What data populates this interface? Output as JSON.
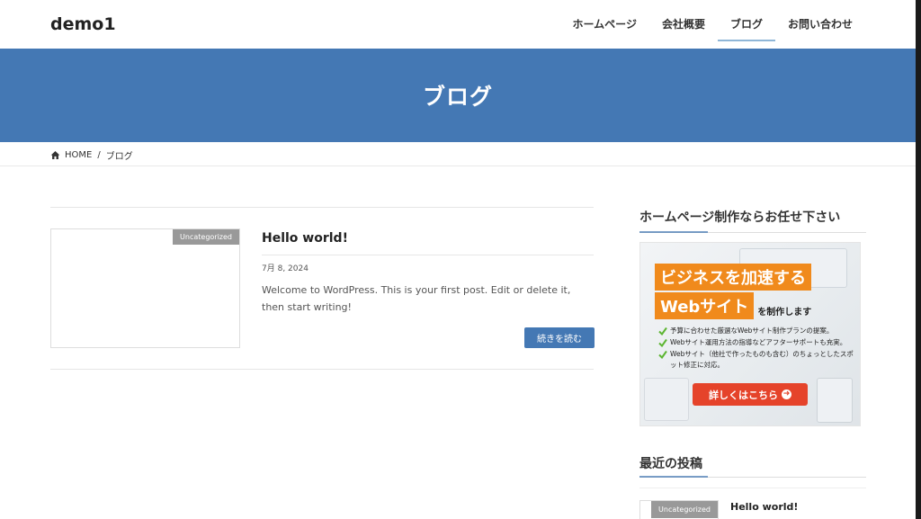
{
  "header": {
    "site_title": "demo1",
    "nav": [
      {
        "label": "ホームページ",
        "active": false
      },
      {
        "label": "会社概要",
        "active": false
      },
      {
        "label": "ブログ",
        "active": true
      },
      {
        "label": "お問い合わせ",
        "active": false
      }
    ]
  },
  "hero": {
    "title": "ブログ"
  },
  "breadcrumb": {
    "home": "HOME",
    "separator": "/",
    "current": "ブログ"
  },
  "post": {
    "category": "Uncategorized",
    "title": "Hello world!",
    "date": "7月 8, 2024",
    "excerpt": "Welcome to WordPress. This is your first post. Edit or delete it, then start writing!",
    "more_label": "続きを読む"
  },
  "sidebar": {
    "widget1_title": "ホームページ制作ならお任せ下さい",
    "banner": {
      "headline1": "ビジネスを加速する",
      "headline2": "Webサイト",
      "headline2_suffix": "を制作します",
      "points": [
        "予算に合わせた厳選なWebサイト制作プランの提案。",
        "Webサイト運用方法の指導などアフターサポートも充実。",
        "Webサイト（他社で作ったものも含む）のちょっとしたスポット修正に対応。"
      ],
      "button_label": "詳しくはこちら"
    },
    "widget2_title": "最近の投稿",
    "recent": [
      {
        "category": "Uncategorized",
        "title": "Hello world!"
      }
    ]
  },
  "colors": {
    "accent": "#4478b4",
    "banner_orange": "#f08a1c",
    "banner_button": "#e5432a",
    "check_green": "#5cb531"
  },
  "icons": {
    "breadcrumb_home": "home-icon",
    "banner_check": "check-icon",
    "banner_arrow": "arrow-circle-right-icon"
  }
}
